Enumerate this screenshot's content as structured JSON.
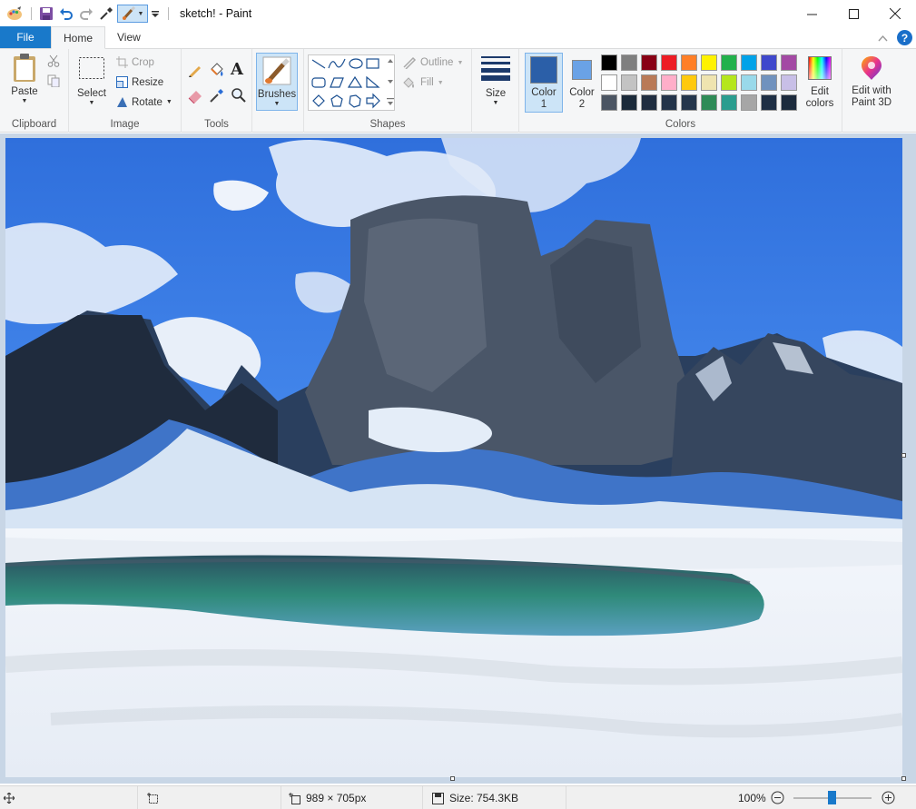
{
  "window": {
    "title": "sketch! - Paint"
  },
  "tabs": {
    "file": "File",
    "home": "Home",
    "view": "View"
  },
  "clipboard": {
    "paste": "Paste",
    "group": "Clipboard"
  },
  "image": {
    "select": "Select",
    "crop": "Crop",
    "resize": "Resize",
    "rotate": "Rotate",
    "group": "Image"
  },
  "tools": {
    "group": "Tools",
    "brushes": "Brushes"
  },
  "shapes": {
    "outline": "Outline",
    "fill": "Fill",
    "group": "Shapes"
  },
  "size": {
    "label": "Size"
  },
  "colors": {
    "color1_line1": "Color",
    "color1_line2": "1",
    "color2_line1": "Color",
    "color2_line2": "2",
    "edit_line1": "Edit",
    "edit_line2": "colors",
    "group": "Colors",
    "color1_value": "#2b5fa8",
    "color2_value": "#6aa2e6",
    "palette_row1": [
      "#000000",
      "#7f7f7f",
      "#880015",
      "#ed1c24",
      "#ff7f27",
      "#fff200",
      "#22b14c",
      "#00a2e8",
      "#3f48cc",
      "#a349a4"
    ],
    "palette_row2": [
      "#ffffff",
      "#c3c3c3",
      "#b97a57",
      "#ffaec9",
      "#ffc90e",
      "#efe4b0",
      "#b5e61d",
      "#99d9ea",
      "#7092be",
      "#c8bfe7"
    ],
    "palette_row3": [
      "#4b5563",
      "#1b2a3a",
      "#1f2d40",
      "#23344a",
      "#24364c",
      "#2e8b57",
      "#2a9d8f",
      "#a6a6a6",
      "#1e2f45",
      "#1c2b3d"
    ]
  },
  "paint3d": {
    "line1": "Edit with",
    "line2": "Paint 3D"
  },
  "status": {
    "dimensions": "989 × 705px",
    "size": "Size: 754.3KB",
    "zoom": "100%"
  }
}
